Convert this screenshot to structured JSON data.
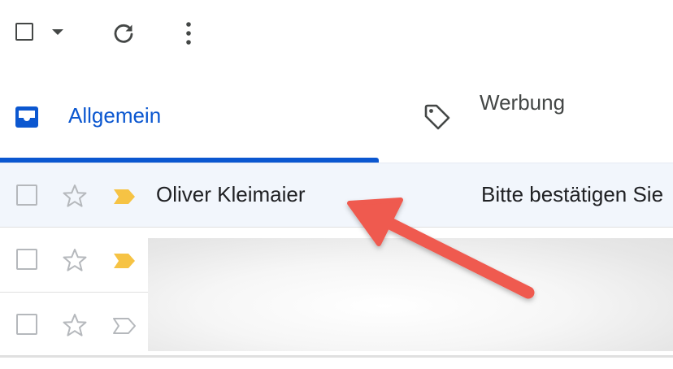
{
  "toolbar": {
    "select_all_icon": "checkbox-icon",
    "select_dropdown_icon": "caret-down-icon",
    "refresh_icon": "refresh-icon",
    "more_icon": "more-vert-icon"
  },
  "tabs": [
    {
      "label": "Allgemein",
      "icon": "inbox-icon",
      "selected": true,
      "color": "#0b57d0"
    },
    {
      "label": "Werbung",
      "icon": "tag-icon",
      "selected": false,
      "color": "#444746"
    }
  ],
  "emails": [
    {
      "sender": "Oliver Kleimaier",
      "subject": "Bitte bestätigen Sie",
      "important": true,
      "starred": false,
      "highlighted": true
    },
    {
      "sender": "",
      "subject": "",
      "important": true,
      "starred": false,
      "redacted": true
    },
    {
      "sender": "",
      "subject": "",
      "important": false,
      "starred": false,
      "redacted": true
    }
  ],
  "colors": {
    "accent": "#0b57d0",
    "important_marker": "#f6c344",
    "annotation_arrow": "#ef5a4f",
    "selected_row_bg": "#f2f6fc"
  },
  "annotation": {
    "type": "arrow",
    "points_to": "sender"
  }
}
